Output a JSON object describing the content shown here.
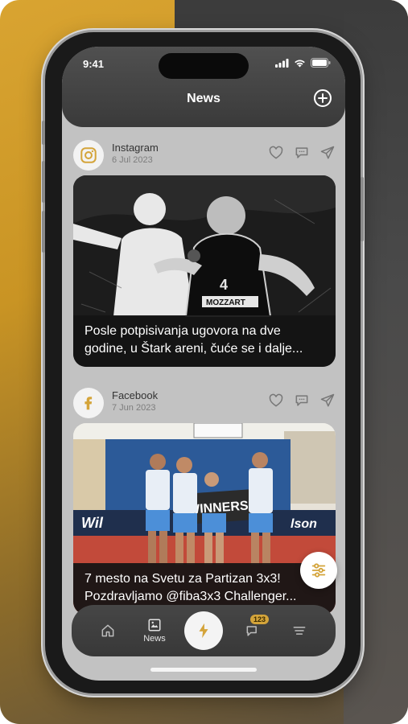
{
  "status": {
    "time": "9:41"
  },
  "header": {
    "title": "News"
  },
  "posts": [
    {
      "source": "Instagram",
      "date": "6 Jul 2023",
      "caption": "Posle potpisivanja ugovora na dve godine, u Štark areni, čuće se i dalje..."
    },
    {
      "source": "Facebook",
      "date": "7 Jun 2023",
      "caption": "7 mesto na Svetu za Partizan 3x3! Pozdravljamo @fiba3x3 Challenger..."
    }
  ],
  "nav": {
    "news_label": "News",
    "badge_count": "123"
  },
  "colors": {
    "accent": "#d4a43a",
    "header": "#3f3f3f",
    "screen_bg": "#c2c2c2"
  }
}
